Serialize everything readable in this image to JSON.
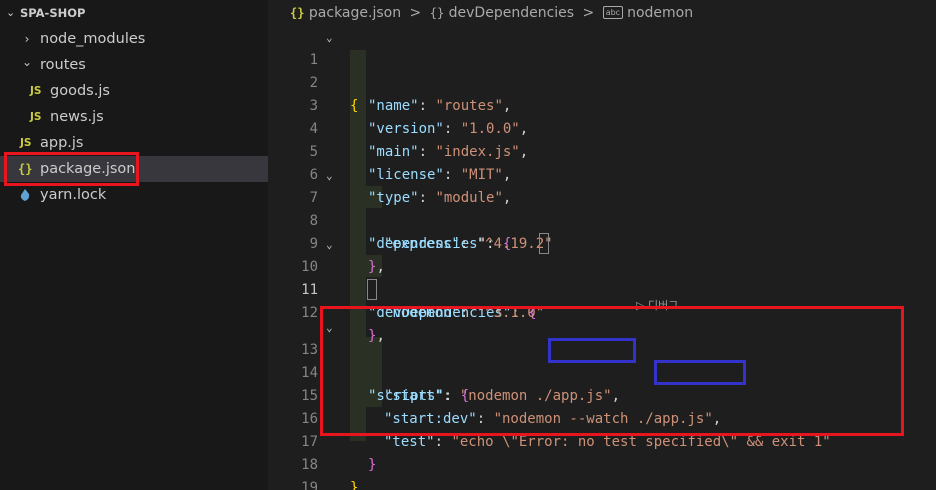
{
  "explorer": {
    "root": "SPA-SHOP",
    "items": [
      {
        "label": "node_modules",
        "type": "folder",
        "state": "collapsed"
      },
      {
        "label": "routes",
        "type": "folder",
        "state": "expanded"
      },
      {
        "label": "goods.js",
        "type": "js"
      },
      {
        "label": "news.js",
        "type": "js"
      },
      {
        "label": "app.js",
        "type": "js"
      },
      {
        "label": "package.json",
        "type": "json",
        "selected": true
      },
      {
        "label": "yarn.lock",
        "type": "yarn"
      }
    ],
    "icons": {
      "js": "JS",
      "json": "{}",
      "chevron_right": "›",
      "chevron_down": "⌄"
    }
  },
  "breadcrumb": {
    "file": "package.json",
    "key": "devDependencies",
    "leaf": "nodemon",
    "sep": ">"
  },
  "codelens": "▷ 디버그",
  "editor": {
    "active_line": 11,
    "lines": [
      {
        "n": "1",
        "fold": "⌄"
      },
      {
        "n": "2"
      },
      {
        "n": "3"
      },
      {
        "n": "4"
      },
      {
        "n": "5"
      },
      {
        "n": "6"
      },
      {
        "n": "7",
        "fold": "⌄"
      },
      {
        "n": "8"
      },
      {
        "n": "9"
      },
      {
        "n": "10",
        "fold": "⌄"
      },
      {
        "n": "11"
      },
      {
        "n": "12"
      },
      {
        "n": "13",
        "fold": "⌄"
      },
      {
        "n": "14"
      },
      {
        "n": "15"
      },
      {
        "n": "16"
      },
      {
        "n": "17"
      },
      {
        "n": "18"
      },
      {
        "n": "19"
      }
    ],
    "tokens": {
      "l1_open": "{",
      "l2_key": "\"name\"",
      "l2_val": "\"routes\"",
      "l3_key": "\"version\"",
      "l3_val": "\"1.0.0\"",
      "l4_key": "\"main\"",
      "l4_val": "\"index.js\"",
      "l5_key": "\"license\"",
      "l5_val": "\"MIT\"",
      "l6_key": "\"type\"",
      "l6_val": "\"module\"",
      "l7_key": "\"dependencies\"",
      "l7_open": "{",
      "l8_key": "\"express\"",
      "l8_val": "\"^4.19.2\"",
      "l9_close": "}",
      "l10_key": "\"devDependencies\"",
      "l10_open": "{",
      "l11_key": "\"nodemon\"",
      "l11_val": "\"^3.1.0\"",
      "l12_close": "}",
      "l13_key": "\"scripts\"",
      "l13_open": "{",
      "l14_key": "\"start\"",
      "l14_val_a": "\"nodemon ",
      "l14_val_b": "./app.js",
      "l14_val_c": "\"",
      "l15_key": "\"start:dev\"",
      "l15_val_a": "\"nodemon --watch ",
      "l15_val_b": "./app.js",
      "l15_val_c": "\"",
      "l16_key": "\"test\"",
      "l16_val": "\"echo \\\"Error: no test specified\\\" && exit 1\"",
      "l17_close": "}",
      "l18_close": "}",
      "colon": ": ",
      "comma": ","
    }
  },
  "colors": {
    "highlight_red": "#e8141e",
    "highlight_blue": "#3333cc",
    "json_key": "#9cdcfe",
    "json_string": "#ce9178",
    "bracket_gold": "#ffd700",
    "bracket_purple": "#da70d6",
    "bracket_blue": "#179fff"
  }
}
